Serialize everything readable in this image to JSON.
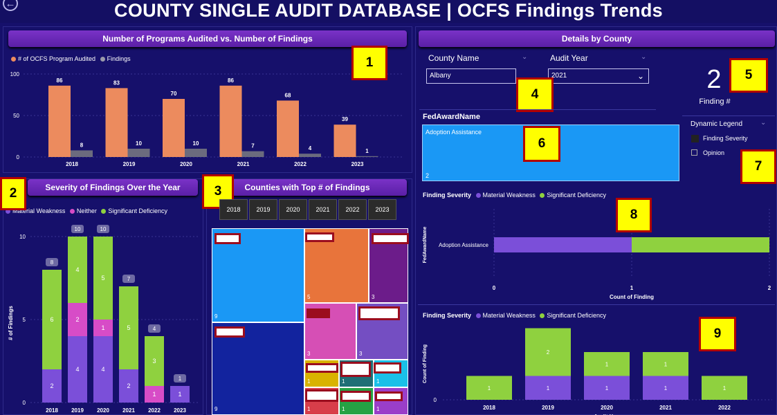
{
  "header": {
    "title": "COUNTY SINGLE AUDIT DATABASE  |  OCFS Findings Trends",
    "back_icon": "arrow-left-circle-icon"
  },
  "colors": {
    "background": "#16106b",
    "header": "#6a28b8",
    "orange": "#ec8b5e",
    "gray": "#6b6b7e",
    "material_weakness": "#7b4fd9",
    "neither": "#d74cc7",
    "significant_deficiency": "#8fd13f",
    "card_blue": "#1a98f5"
  },
  "panel1": {
    "title": "Number of Programs Audited vs. Number of Findings",
    "callout": "1",
    "legend": [
      "# of OCFS Program Audited",
      "Findings"
    ]
  },
  "panel2": {
    "title": "Severity of Findings Over the Year",
    "callout": "2",
    "legend": [
      "Material Weakness",
      "Neither",
      "Significant Deficiency"
    ],
    "ylabel": "# of Findings"
  },
  "panel3": {
    "title": "Counties with Top # of Findings",
    "callout": "3",
    "years": [
      "2018",
      "2019",
      "2020",
      "2021",
      "2022",
      "2023"
    ],
    "tiles": [
      "9",
      "5",
      "3",
      "9",
      "3",
      "3",
      "1",
      "1",
      "1",
      "1",
      "1",
      "1"
    ]
  },
  "details": {
    "title": "Details by County",
    "county_label": "County Name",
    "county_value": "Albany",
    "year_label": "Audit Year",
    "year_value": "2021",
    "callout_4": "4",
    "callout_5": "5",
    "callout_6": "6",
    "callout_7": "7",
    "callout_8": "8",
    "callout_9": "9",
    "finding_count": "2",
    "finding_label": "Finding #",
    "fed_award_header": "FedAwardName",
    "card_title": "Adoption Assistance",
    "card_value": "2",
    "dynamic_legend_label": "Dynamic Legend",
    "options": [
      "Finding Severity",
      "Opinion"
    ],
    "severity_legend_label": "Finding Severity",
    "severity_legend": [
      "Material Weakness",
      "Significant Deficiency"
    ],
    "bar_ylabel": "FedAwardName",
    "bar_category": "Adoption Assistance",
    "bar_xlabel": "Count of Finding",
    "col_ylabel": "Count of Finding",
    "col_xlabel": "Audit Year"
  },
  "chart_data": [
    {
      "type": "bar",
      "title": "Number of Programs Audited vs. Number of Findings",
      "categories": [
        "2018",
        "2019",
        "2020",
        "2021",
        "2022",
        "2023"
      ],
      "series": [
        {
          "name": "# of OCFS Program Audited",
          "values": [
            86,
            83,
            70,
            86,
            68,
            39
          ]
        },
        {
          "name": "Findings",
          "values": [
            8,
            10,
            10,
            7,
            4,
            1
          ]
        }
      ],
      "yticks": [
        "0",
        "50",
        "100"
      ],
      "ylim": [
        0,
        100
      ]
    },
    {
      "type": "bar",
      "stacked": true,
      "title": "Severity of Findings Over the Year",
      "categories": [
        "2018",
        "2019",
        "2020",
        "2021",
        "2022",
        "2023"
      ],
      "series": [
        {
          "name": "Material Weakness",
          "values": [
            2,
            4,
            4,
            2,
            0,
            1
          ]
        },
        {
          "name": "Neither",
          "values": [
            0,
            2,
            1,
            0,
            1,
            0
          ]
        },
        {
          "name": "Significant Deficiency",
          "values": [
            6,
            4,
            5,
            5,
            3,
            0
          ]
        }
      ],
      "totals": [
        8,
        10,
        10,
        7,
        4,
        1
      ],
      "yticks": [
        "0",
        "5",
        "10"
      ],
      "ylim": [
        0,
        10
      ],
      "ylabel": "# of Findings"
    },
    {
      "type": "bar",
      "orientation": "horizontal",
      "stacked": true,
      "categories": [
        "Adoption Assistance"
      ],
      "series": [
        {
          "name": "Material Weakness",
          "values": [
            1
          ]
        },
        {
          "name": "Significant Deficiency",
          "values": [
            1
          ]
        }
      ],
      "xticks": [
        "0",
        "1",
        "2"
      ],
      "xlim": [
        0,
        2
      ],
      "xlabel": "Count of Finding",
      "ylabel": "FedAwardName"
    },
    {
      "type": "bar",
      "stacked": true,
      "categories": [
        "2018",
        "2019",
        "2020",
        "2021",
        "2022"
      ],
      "series": [
        {
          "name": "Material Weakness",
          "values": [
            0,
            1,
            1,
            1,
            0
          ]
        },
        {
          "name": "Significant Deficiency",
          "values": [
            1,
            2,
            1,
            1,
            1
          ]
        }
      ],
      "yticks": [
        "0"
      ],
      "ylabel": "Count of Finding",
      "xlabel": "Audit Year"
    }
  ]
}
